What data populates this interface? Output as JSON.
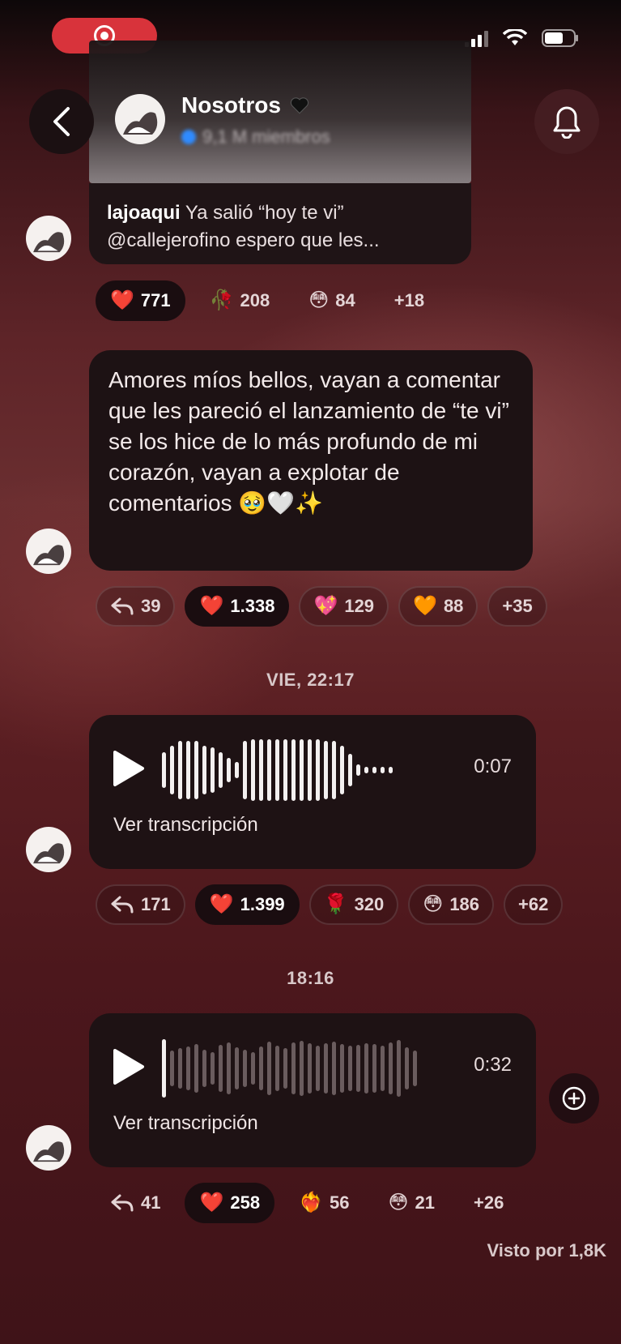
{
  "status_bar": {
    "recording_icon": "screen-record-icon",
    "signal_icon": "cellular-signal-icon",
    "wifi_icon": "wifi-icon",
    "battery_icon": "battery-icon"
  },
  "header": {
    "channel_name": "Nosotros",
    "channel_badge_icon": "black-heart-icon",
    "channel_subtitle": "9,1 M miembros",
    "back_icon": "chevron-left-icon",
    "bell_icon": "bell-icon"
  },
  "messages": [
    {
      "type": "shared-post",
      "author": "lajoaqui",
      "text": "Ya salió “hoy te vi” @callejerofino  espero que les...",
      "reactions": [
        {
          "emoji": "❤️",
          "count": "771",
          "active": true
        },
        {
          "emoji": "🥀",
          "count": "208",
          "active": false
        },
        {
          "emoji": "😳",
          "count": "84",
          "active": false
        },
        {
          "emoji": "",
          "count": "+18",
          "active": false
        }
      ]
    },
    {
      "type": "text",
      "text": "Amores míos bellos, vayan a comentar que les pareció el lanzamiento de “te vi” se los hice de lo más profundo de mi corazón, vayan a explotar de comentarios 🥹🤍✨",
      "replies": "39",
      "reactions": [
        {
          "emoji": "❤️",
          "count": "1.338",
          "active": true
        },
        {
          "emoji": "💖",
          "count": "129",
          "active": false
        },
        {
          "emoji": "🧡",
          "count": "88",
          "active": false
        },
        {
          "emoji": "",
          "count": "+35",
          "active": false
        }
      ]
    },
    {
      "type": "separator",
      "label": "VIE, 22:17"
    },
    {
      "type": "voice",
      "duration": "0:07",
      "transcript_label": "Ver transcripción",
      "replies": "171",
      "reactions": [
        {
          "emoji": "❤️",
          "count": "1.399",
          "active": true
        },
        {
          "emoji": "🌹",
          "count": "320",
          "active": false
        },
        {
          "emoji": "😳",
          "count": "186",
          "active": false
        },
        {
          "emoji": "",
          "count": "+62",
          "active": false
        }
      ]
    },
    {
      "type": "separator",
      "label": "18:16"
    },
    {
      "type": "voice",
      "duration": "0:32",
      "transcript_label": "Ver transcripción",
      "replies": "41",
      "reactions": [
        {
          "emoji": "❤️",
          "count": "258",
          "active": true
        },
        {
          "emoji": "❤️‍🔥",
          "count": "56",
          "active": false
        },
        {
          "emoji": "😳",
          "count": "21",
          "active": false
        },
        {
          "emoji": "",
          "count": "+26",
          "active": false
        }
      ]
    }
  ],
  "seen_by": "Visto por 1,8K",
  "add_reaction_icon": "add-reaction-icon"
}
